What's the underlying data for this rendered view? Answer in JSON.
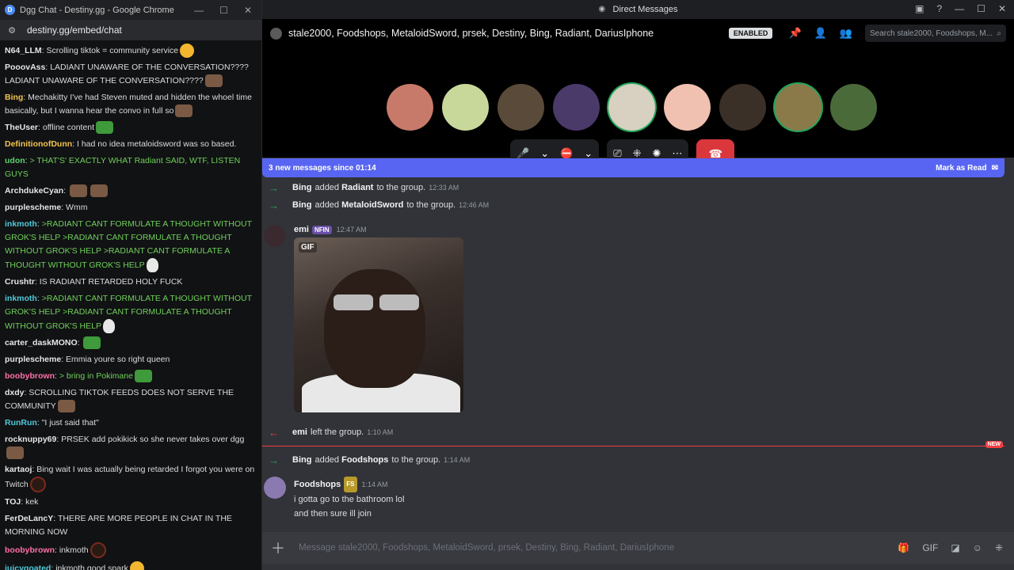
{
  "chrome": {
    "title": "Dgg Chat - Destiny.gg - Google Chrome",
    "url": "destiny.gg/embed/chat",
    "min": "—",
    "max": "☐",
    "close": "✕"
  },
  "chat": [
    {
      "user": "N64_LLM",
      "cls": "",
      "text": "Scrolling tiktok = community service",
      "emotes": [
        "yel"
      ]
    },
    {
      "user": "PooovAss",
      "cls": "",
      "text": "LADIANT UNAWARE OF THE CONVERSATION???? LADIANT UNAWARE OF THE CONVERSATION????",
      "emotes": [
        "face"
      ]
    },
    {
      "user": "Bing",
      "cls": "o",
      "text": "Mechakitty I've had Steven muted and hidden the whoel time basically, but I wanna hear the convo in full so",
      "emotes": [
        "face"
      ]
    },
    {
      "user": "TheUser",
      "cls": "",
      "text": "offline content",
      "emotes": [
        "pepe"
      ]
    },
    {
      "user": "DefinitionofDunn",
      "cls": "o",
      "text": "I had no idea metaloidsword was so based.",
      "emotes": []
    },
    {
      "user": "udon",
      "cls": "g",
      "text": "> THAT'S' EXACTLY WHAT Radiant SAID, WTF, LISTEN GUYS",
      "green": true,
      "emotes": []
    },
    {
      "user": "ArchdukeCyan",
      "cls": "",
      "text": "",
      "emotes": [
        "face",
        "face"
      ]
    },
    {
      "user": "purplescheme",
      "cls": "",
      "text": "Wmm",
      "emotes": []
    },
    {
      "user": "inkmoth",
      "cls": "c",
      "text": ">RADIANT CANT FORMULATE A THOUGHT WITHOUT GROK'S HELP >RADIANT CANT FORMULATE A THOUGHT WITHOUT GROK'S HELP >RADIANT CANT FORMULATE A THOUGHT WITHOUT GROK'S HELP",
      "green": true,
      "emotes": [
        "skull"
      ]
    },
    {
      "user": "Crushtr",
      "cls": "",
      "text": "IS RADIANT RETARDED HOLY FUCK",
      "emotes": []
    },
    {
      "user": "inkmoth",
      "cls": "c",
      "text": ">RADIANT CANT FORMULATE A THOUGHT WITHOUT GROK'S HELP >RADIANT CANT FORMULATE A THOUGHT WITHOUT GROK'S HELP",
      "green": true,
      "emotes": [
        "skull"
      ]
    },
    {
      "user": "carter_daskMONO",
      "cls": "",
      "text": "",
      "emotes": [
        "pepe"
      ]
    },
    {
      "user": "purplescheme",
      "cls": "",
      "text": "Emmia youre so right queen",
      "emotes": []
    },
    {
      "user": "boobybrown",
      "cls": "p",
      "text": "> bring in Pokimane",
      "green": true,
      "emotes": [
        "pepe"
      ]
    },
    {
      "user": "dxdy",
      "cls": "",
      "text": "SCROLLING TIKTOK FEEDS DOES NOT SERVE THE COMMUNITY",
      "emotes": [
        "face"
      ]
    },
    {
      "user": "RunRun",
      "cls": "c",
      "text": "\"I just said that\"",
      "emotes": []
    },
    {
      "user": "rocknuppy69",
      "cls": "",
      "text": "PRSEK add pokikick so she never takes over dgg",
      "emotes": [
        "face"
      ]
    },
    {
      "user": "kartaoj",
      "cls": "",
      "text": "Bing wait I was actually being retarded I forgot you were on Twitch",
      "emotes": [
        "dark"
      ]
    },
    {
      "user": "TOJ",
      "cls": "",
      "text": "kek",
      "emotes": []
    },
    {
      "user": "FerDeLancY",
      "cls": "",
      "text": "THERE ARE MORE PEOPLE IN CHAT IN THE MORNING NOW",
      "emotes": []
    },
    {
      "user": "boobybrown",
      "cls": "p",
      "text": "inkmoth",
      "emotes": [
        "dark"
      ]
    },
    {
      "user": "juicygoated",
      "cls": "c",
      "text": "inkmoth good spark",
      "emotes": [
        "yel"
      ]
    }
  ],
  "discord": {
    "title": "Direct Messages",
    "group_name": "stale2000, Foodshops, MetaloidSword, prsek, Destiny, Bing, Radiant, DariusIphone",
    "enabled": "ENABLED",
    "search_placeholder": "Search stale2000, Foodshops, M...",
    "new_messages": "3 new messages since 01:14",
    "mark_read": "Mark as Read",
    "composer_placeholder": "Message stale2000, Foodshops, MetaloidSword, prsek, Destiny, Bing, Radiant, DariusIphone",
    "avatars": [
      {
        "color": "#c87a6a",
        "ring": false
      },
      {
        "color": "#c8d89a",
        "ring": false
      },
      {
        "color": "#5a4a3a",
        "ring": false
      },
      {
        "color": "#4a3a6a",
        "ring": false
      },
      {
        "color": "#d8d0c0",
        "ring": true
      },
      {
        "color": "#f0c0b0",
        "ring": false
      },
      {
        "color": "#3a3028",
        "ring": false
      },
      {
        "color": "#8a7a4a",
        "ring": true
      },
      {
        "color": "#4a6a3a",
        "ring": false
      }
    ],
    "sys1": {
      "actor": "Bing",
      "mid": "added",
      "target": "Radiant",
      "tail": "to the group.",
      "time": "12:33 AM"
    },
    "sys2": {
      "actor": "Bing",
      "mid": "added",
      "target": "MetaloidSword",
      "tail": "to the group.",
      "time": "12:46 AM"
    },
    "emi_post": {
      "name": "emi",
      "tag": "NFIN",
      "time": "12:47 AM",
      "gif_label": "GIF"
    },
    "sys3": {
      "actor": "emi",
      "mid": "left the group.",
      "time": "1:10 AM"
    },
    "new_badge": "NEW",
    "sys4": {
      "actor": "Bing",
      "mid": "added",
      "target": "Foodshops",
      "tail": "to the group.",
      "time": "1:14 AM"
    },
    "food_post": {
      "name": "Foodshops",
      "tag": "FS",
      "time": "1:14 AM",
      "line1": "i gotta go to the bathroom lol",
      "line2": "and then sure ill join"
    }
  }
}
